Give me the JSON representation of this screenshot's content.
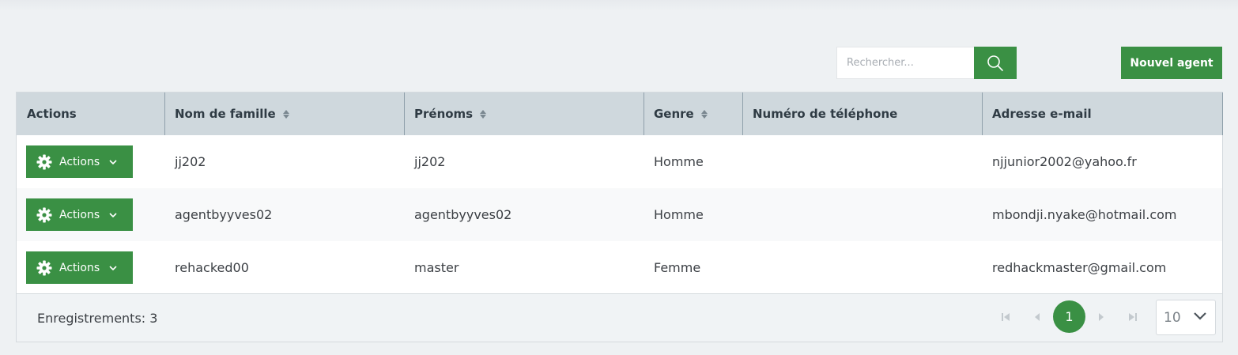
{
  "toolbar": {
    "search_placeholder": "Rechercher...",
    "new_agent_label": "Nouvel agent"
  },
  "table": {
    "columns": [
      {
        "label": "Actions",
        "sortable": false
      },
      {
        "label": "Nom de famille",
        "sortable": true
      },
      {
        "label": "Prénoms",
        "sortable": true
      },
      {
        "label": "Genre",
        "sortable": true
      },
      {
        "label": "Numéro de téléphone",
        "sortable": false
      },
      {
        "label": "Adresse e-mail",
        "sortable": false
      }
    ],
    "action_button_label": "Actions",
    "rows": [
      {
        "nom": "jj202",
        "prenoms": "jj202",
        "genre": "Homme",
        "telephone": "",
        "email": "njjunior2002@yahoo.fr"
      },
      {
        "nom": "agentbyyves02",
        "prenoms": "agentbyyves02",
        "genre": "Homme",
        "telephone": "",
        "email": "mbondji.nyake@hotmail.com"
      },
      {
        "nom": "rehacked00",
        "prenoms": "master",
        "genre": "Femme",
        "telephone": "",
        "email": "redhackmaster@gmail.com"
      }
    ]
  },
  "footer": {
    "records_label": "Enregistrements: 3",
    "current_page": "1",
    "page_size": "10"
  },
  "icons": {
    "search": "search-icon",
    "gear": "gear-icon",
    "chevron": "chevron-down-icon",
    "sort": "sort-icon",
    "first": "first-page-icon",
    "prev": "previous-page-icon",
    "next": "next-page-icon",
    "last": "last-page-icon"
  },
  "colors": {
    "accent": "#3a9044",
    "header_bg": "#cfd8dd",
    "page_bg": "#eef1f3"
  }
}
